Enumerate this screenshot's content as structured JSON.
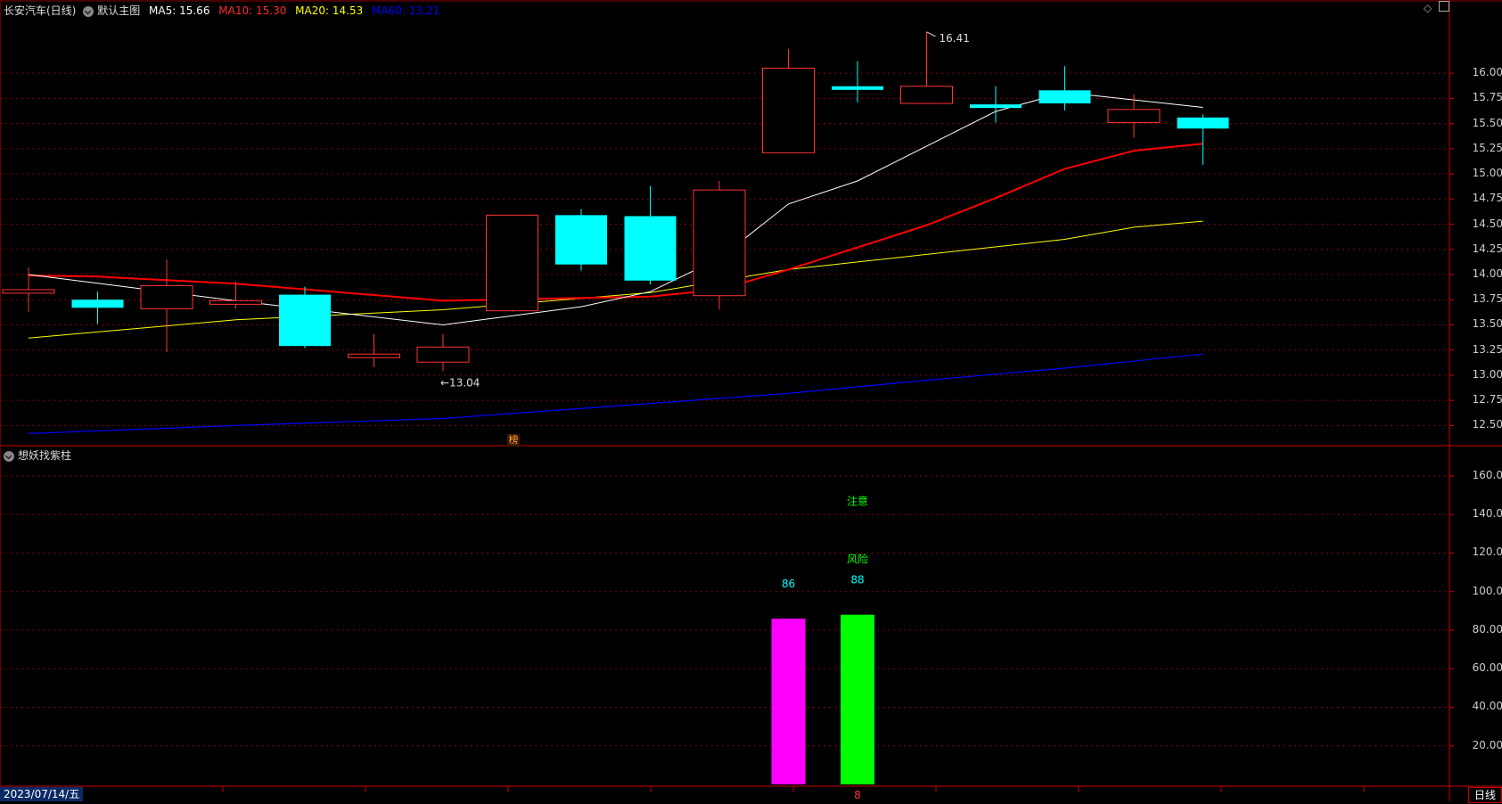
{
  "header": {
    "stock": "长安汽车(日线)",
    "main_chart": "默认主图",
    "ma5": "MA5: 15.66",
    "ma10": "MA10: 15.30",
    "ma20": "MA20: 14.53",
    "ma60": "MA60: 13.21"
  },
  "indicator": {
    "name": "想妖找紫柱",
    "note1": "注意",
    "note2": "风险",
    "bar_labels": [
      "86",
      "88"
    ]
  },
  "footer": {
    "date": "2023/07/14/五",
    "period": "日线",
    "marker": "8"
  },
  "badge": "榜",
  "colors": {
    "up": "#ff3333",
    "down": "#00ffff",
    "ma5": "#ffffff",
    "ma10": "#ff0000",
    "ma20": "#ffff00",
    "ma60": "#0000ff",
    "grid": "#8b0000",
    "magenta": "#ff00ff",
    "green": "#00ff00"
  },
  "chart_data": [
    {
      "type": "candlestick",
      "y_ticks": [
        "16.00",
        "15.75",
        "15.50",
        "15.25",
        "15.00",
        "14.75",
        "14.50",
        "14.25",
        "14.00",
        "13.75",
        "13.50",
        "13.25",
        "13.00",
        "12.75",
        "12.50"
      ],
      "ylim": [
        12.3,
        16.55
      ],
      "candles": [
        {
          "o": 13.85,
          "h": 14.07,
          "l": 13.63,
          "c": 13.85
        },
        {
          "o": 13.75,
          "h": 13.83,
          "l": 13.51,
          "c": 13.67
        },
        {
          "o": 13.66,
          "h": 14.15,
          "l": 13.23,
          "c": 13.89
        },
        {
          "o": 13.71,
          "h": 13.93,
          "l": 13.66,
          "c": 13.74
        },
        {
          "o": 13.8,
          "h": 13.88,
          "l": 13.27,
          "c": 13.29
        },
        {
          "o": 13.18,
          "h": 13.41,
          "l": 13.08,
          "c": 13.21
        },
        {
          "o": 13.13,
          "h": 13.41,
          "l": 13.04,
          "c": 13.28
        },
        {
          "o": 13.64,
          "h": 14.59,
          "l": 13.63,
          "c": 14.59
        },
        {
          "o": 14.59,
          "h": 14.65,
          "l": 14.04,
          "c": 14.1
        },
        {
          "o": 14.58,
          "h": 14.88,
          "l": 13.9,
          "c": 13.94
        },
        {
          "o": 13.79,
          "h": 14.93,
          "l": 13.65,
          "c": 14.84
        },
        {
          "o": 15.21,
          "h": 16.24,
          "l": 15.21,
          "c": 16.05
        },
        {
          "o": 15.87,
          "h": 16.12,
          "l": 15.71,
          "c": 15.85
        },
        {
          "o": 15.7,
          "h": 16.41,
          "l": 15.7,
          "c": 15.87
        },
        {
          "o": 15.69,
          "h": 15.87,
          "l": 15.51,
          "c": 15.66
        },
        {
          "o": 15.83,
          "h": 16.07,
          "l": 15.63,
          "c": 15.7
        },
        {
          "o": 15.51,
          "h": 15.79,
          "l": 15.36,
          "c": 15.64
        },
        {
          "o": 15.56,
          "h": 15.59,
          "l": 15.09,
          "c": 15.45
        }
      ],
      "ma5": [
        [
          0,
          14.0
        ],
        [
          3,
          13.74
        ],
        [
          6,
          13.5
        ],
        [
          8,
          13.68
        ],
        [
          9,
          13.83
        ],
        [
          10,
          14.16
        ],
        [
          11,
          14.7
        ],
        [
          12,
          14.93
        ],
        [
          14,
          15.62
        ],
        [
          15,
          15.81
        ],
        [
          17,
          15.66
        ]
      ],
      "ma10": [
        [
          0,
          13.99
        ],
        [
          1,
          13.98
        ],
        [
          3,
          13.91
        ],
        [
          6,
          13.74
        ],
        [
          9,
          13.78
        ],
        [
          10,
          13.85
        ],
        [
          11,
          14.05
        ],
        [
          13,
          14.49
        ],
        [
          14,
          14.76
        ],
        [
          15,
          15.05
        ],
        [
          16,
          15.23
        ],
        [
          17,
          15.3
        ]
      ],
      "ma20": [
        [
          0,
          13.37
        ],
        [
          3,
          13.55
        ],
        [
          6,
          13.65
        ],
        [
          9,
          13.82
        ],
        [
          11,
          14.05
        ],
        [
          13,
          14.2
        ],
        [
          15,
          14.35
        ],
        [
          16,
          14.47
        ],
        [
          17,
          14.53
        ]
      ],
      "ma60": [
        [
          0,
          12.42
        ],
        [
          3,
          12.5
        ],
        [
          6,
          12.57
        ],
        [
          9,
          12.72
        ],
        [
          11,
          12.82
        ],
        [
          13,
          12.95
        ],
        [
          15,
          13.07
        ],
        [
          17,
          13.21
        ]
      ],
      "annotations": [
        {
          "text": "←13.04",
          "candle": 6,
          "value": 13.04
        },
        {
          "text": "16.41",
          "candle": 13,
          "value": 16.41
        }
      ]
    },
    {
      "type": "bar",
      "y_ticks": [
        "160.0",
        "140.0",
        "120.0",
        "100.0",
        "80.00",
        "60.00",
        "40.00",
        "20.00"
      ],
      "ylim": [
        0,
        172
      ],
      "bars": [
        {
          "candle": 11,
          "value": 86,
          "color": "#ff00ff"
        },
        {
          "candle": 12,
          "value": 88,
          "color": "#00ff00"
        }
      ]
    }
  ]
}
